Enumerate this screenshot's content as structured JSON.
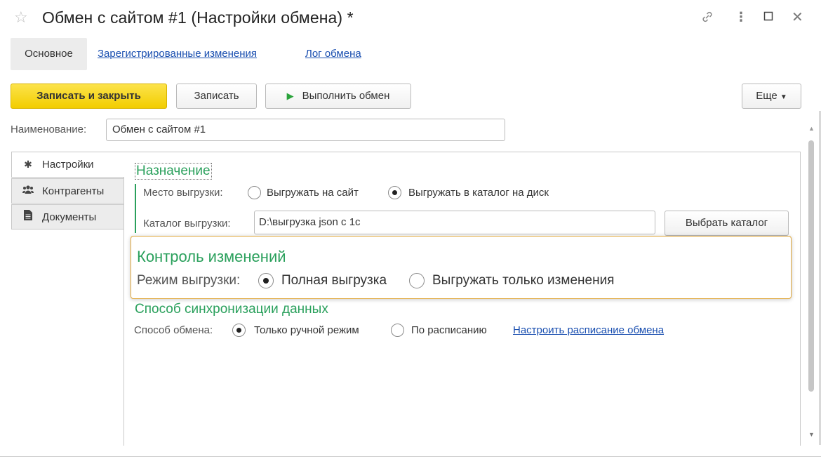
{
  "window": {
    "title": "Обмен с сайтом #1 (Настройки обмена) *",
    "icons": [
      "star-icon",
      "link-icon",
      "more-vertical-icon",
      "maximize-icon",
      "close-icon"
    ]
  },
  "nav": {
    "main": "Основное",
    "registered": "Зарегистрированные изменения",
    "log": "Лог обмена"
  },
  "toolbar": {
    "save_close": "Записать и закрыть",
    "save": "Записать",
    "run_exchange": "Выполнить обмен",
    "more": "Еще"
  },
  "form": {
    "name_label": "Наименование:",
    "name_value": "Обмен с сайтом #1"
  },
  "sidetabs": [
    {
      "label": "Настройки",
      "icon": "gear-icon"
    },
    {
      "label": "Контрагенты",
      "icon": "users-icon"
    },
    {
      "label": "Документы",
      "icon": "document-icon"
    }
  ],
  "destination": {
    "title": "Назначение",
    "place_label": "Место выгрузки:",
    "option_site": "Выгружать на сайт",
    "option_disk": "Выгружать в каталог на диск",
    "selected": "Выгружать в каталог на диск",
    "catalog_label": "Каталог выгрузки:",
    "catalog_value": "D:\\выгрузка json с 1с",
    "choose_button": "Выбрать каталог"
  },
  "changes": {
    "title": "Контроль изменений",
    "mode_label": "Режим выгрузки:",
    "option_full": "Полная выгрузка",
    "option_changes": "Выгружать только изменения",
    "selected": "Полная выгрузка"
  },
  "sync": {
    "title": "Способ синхронизации данных",
    "method_label": "Способ обмена:",
    "option_manual": "Только ручной режим",
    "option_schedule": "По расписанию",
    "selected": "Только ручной режим",
    "schedule_link": "Настроить расписание обмена"
  },
  "colors": {
    "accent_green": "#2aa05c",
    "primary_button": "#f2cd00",
    "link": "#1a4fb0",
    "popup_border": "#e0a83c"
  }
}
